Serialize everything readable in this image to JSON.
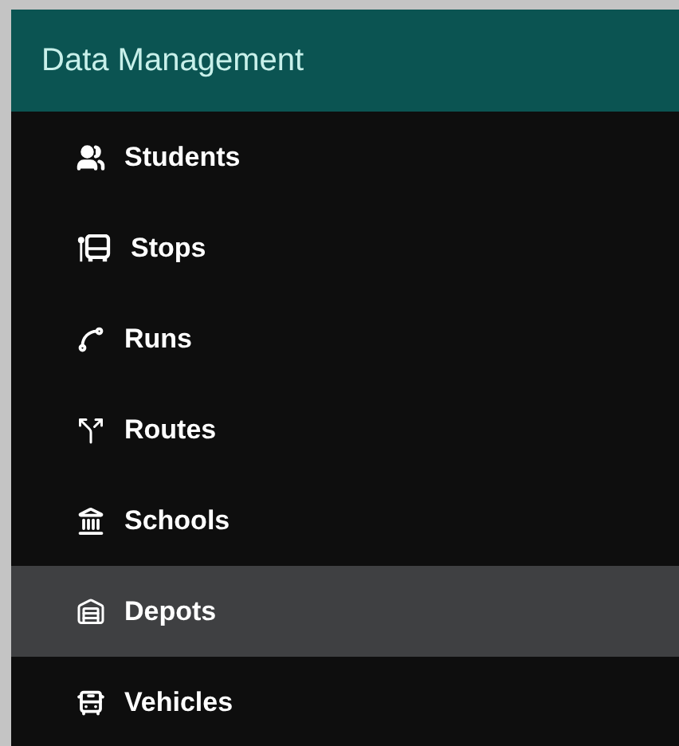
{
  "header": {
    "title": "Data Management"
  },
  "items": [
    {
      "label": "Students",
      "selected": false
    },
    {
      "label": "Stops",
      "selected": false
    },
    {
      "label": "Runs",
      "selected": false
    },
    {
      "label": "Routes",
      "selected": false
    },
    {
      "label": "Schools",
      "selected": false
    },
    {
      "label": "Depots",
      "selected": true
    },
    {
      "label": "Vehicles",
      "selected": false
    }
  ]
}
